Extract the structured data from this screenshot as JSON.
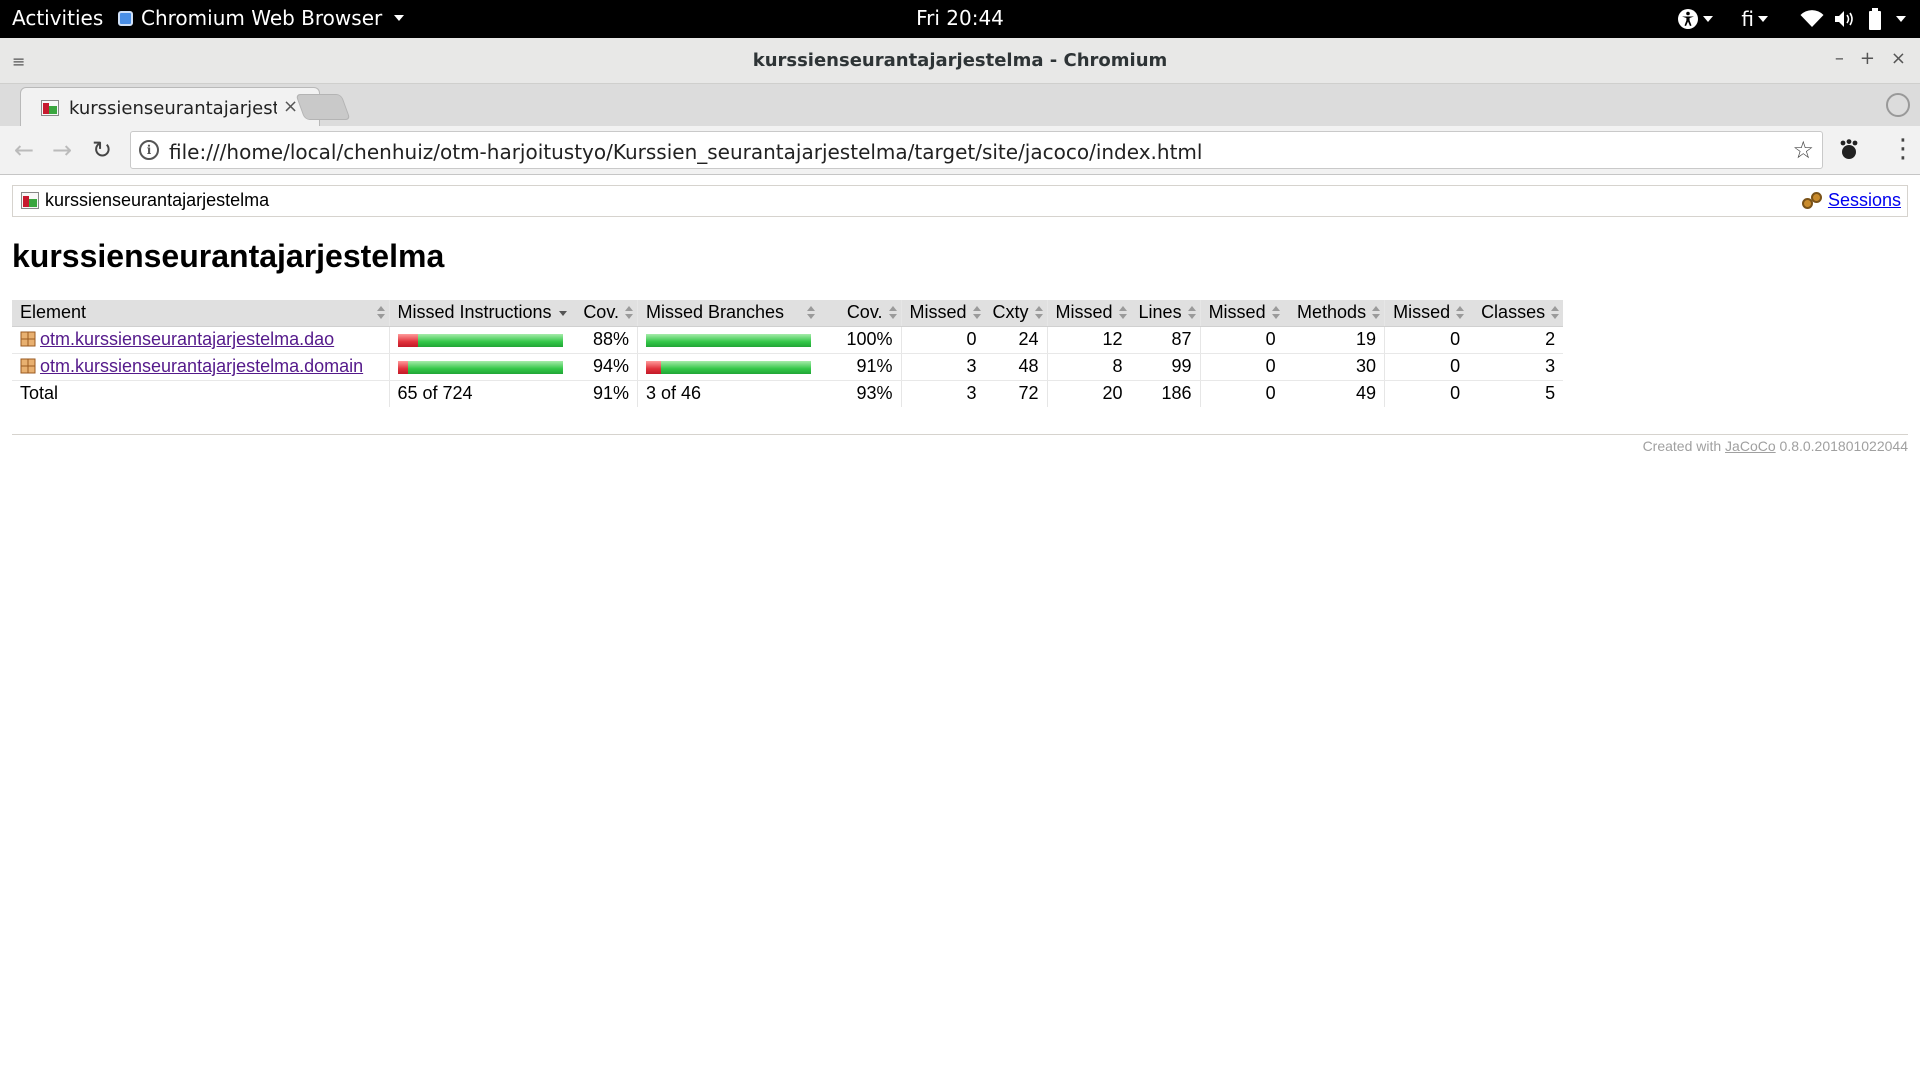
{
  "system": {
    "activities": "Activities",
    "app_name": "Chromium Web Browser",
    "clock": "Fri 20:44",
    "language": "fi"
  },
  "window": {
    "title": "kurssienseurantajarjestelma - Chromium"
  },
  "tab": {
    "title": "kurssienseurantajarjest",
    "close": "×"
  },
  "toolbar": {
    "url": "file:///home/local/chenhuiz/otm-harjoitustyo/Kurssien_seurantajarjestelma/target/site/jacoco/index.html",
    "back": "←",
    "forward": "→",
    "reload": "↻",
    "star": "☆",
    "menu": "⋮",
    "info": "i"
  },
  "page": {
    "breadcrumb": "kurssienseurantajarjestelma",
    "sessions": "Sessions",
    "heading": "kurssienseurantajarjestelma",
    "footer_prefix": "Created with",
    "footer_link": "JaCoCo",
    "footer_version": "0.8.0.201801022044"
  },
  "table": {
    "headers": {
      "element": "Element",
      "missed_instructions": "Missed Instructions",
      "cov1": "Cov.",
      "missed_branches": "Missed Branches",
      "cov2": "Cov.",
      "missed_cxty": "Missed",
      "cxty": "Cxty",
      "missed_lines": "Missed",
      "lines": "Lines",
      "missed_methods": "Missed",
      "methods": "Methods",
      "missed_classes": "Missed",
      "classes": "Classes"
    },
    "rows": [
      {
        "name": "otm.kurssienseurantajarjestelma.dao",
        "instr_missed_fraction": 0.12,
        "instr_covered_fraction": 0.88,
        "instr_cov": "88%",
        "branch_missed_fraction": 0,
        "branch_covered_fraction": 1.0,
        "branch_cov": "100%",
        "missed_cxty": "0",
        "cxty": "24",
        "missed_lines": "12",
        "lines": "87",
        "missed_methods": "0",
        "methods": "19",
        "missed_classes": "0",
        "classes": "2"
      },
      {
        "name": "otm.kurssienseurantajarjestelma.domain",
        "instr_missed_fraction": 0.06,
        "instr_covered_fraction": 0.94,
        "instr_cov": "94%",
        "branch_missed_fraction": 0.09,
        "branch_covered_fraction": 0.91,
        "branch_cov": "91%",
        "missed_cxty": "3",
        "cxty": "48",
        "missed_lines": "8",
        "lines": "99",
        "missed_methods": "0",
        "methods": "30",
        "missed_classes": "0",
        "classes": "3"
      }
    ],
    "total": {
      "label": "Total",
      "instructions": "65 of 724",
      "instr_cov": "91%",
      "branches": "3 of 46",
      "branch_cov": "93%",
      "missed_cxty": "3",
      "cxty": "72",
      "missed_lines": "20",
      "lines": "186",
      "missed_methods": "0",
      "methods": "49",
      "missed_classes": "0",
      "classes": "5"
    }
  },
  "colors": {
    "bar_red": "#e0313b",
    "bar_green": "#33c748",
    "link": "#0000ee",
    "visited_link": "#551a8b"
  }
}
